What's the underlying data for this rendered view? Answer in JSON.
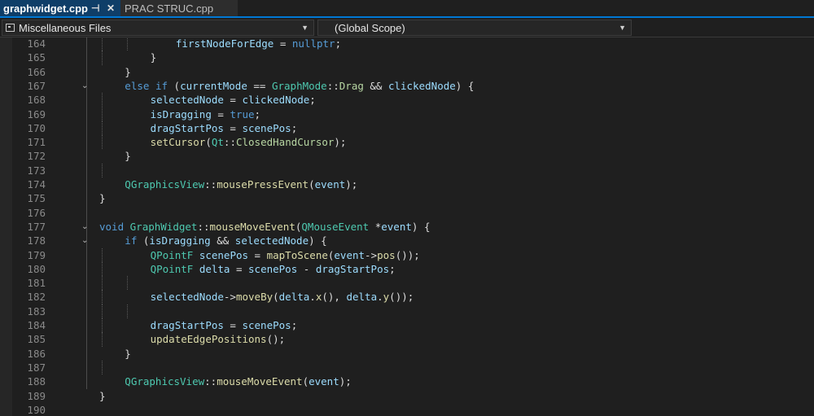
{
  "tabs": [
    {
      "label": "graphwidget.cpp",
      "active": true
    },
    {
      "label": "PRAC STRUC.cpp",
      "active": false
    }
  ],
  "tab_icons": {
    "pin": "pin-icon",
    "close": "close-icon"
  },
  "nav": {
    "project_combo": "Miscellaneous Files",
    "scope_combo": "(Global Scope)"
  },
  "colors": {
    "keyword": "#569cd6",
    "type": "#4ec9b0",
    "function": "#dcdcaa",
    "variable": "#9cdcfe",
    "plain": "#dcdcdc",
    "active_tab": "#0f3e68",
    "accent": "#0078d4"
  },
  "code_lines": [
    {
      "num": "164",
      "indent": 3,
      "fold": false,
      "tokens": [
        [
          "v",
          "firstNodeForEdge"
        ],
        [
          "p",
          " = "
        ],
        [
          "k",
          "nullptr"
        ],
        [
          "p",
          ";"
        ]
      ]
    },
    {
      "num": "165",
      "indent": 2,
      "fold": false,
      "tokens": [
        [
          "p",
          "}"
        ]
      ]
    },
    {
      "num": "166",
      "indent": 1,
      "fold": false,
      "tokens": [
        [
          "p",
          "}"
        ]
      ]
    },
    {
      "num": "167",
      "indent": 1,
      "fold": true,
      "tokens": [
        [
          "k",
          "else"
        ],
        [
          "p",
          " "
        ],
        [
          "k",
          "if"
        ],
        [
          "p",
          " ("
        ],
        [
          "v",
          "currentMode"
        ],
        [
          "p",
          " == "
        ],
        [
          "t",
          "GraphMode"
        ],
        [
          "p",
          "::"
        ],
        [
          "n",
          "Drag"
        ],
        [
          "p",
          " && "
        ],
        [
          "v",
          "clickedNode"
        ],
        [
          "p",
          ") {"
        ]
      ]
    },
    {
      "num": "168",
      "indent": 2,
      "fold": false,
      "tokens": [
        [
          "v",
          "selectedNode"
        ],
        [
          "p",
          " = "
        ],
        [
          "v",
          "clickedNode"
        ],
        [
          "p",
          ";"
        ]
      ]
    },
    {
      "num": "169",
      "indent": 2,
      "fold": false,
      "tokens": [
        [
          "v",
          "isDragging"
        ],
        [
          "p",
          " = "
        ],
        [
          "k",
          "true"
        ],
        [
          "p",
          ";"
        ]
      ]
    },
    {
      "num": "170",
      "indent": 2,
      "fold": false,
      "tokens": [
        [
          "v",
          "dragStartPos"
        ],
        [
          "p",
          " = "
        ],
        [
          "v",
          "scenePos"
        ],
        [
          "p",
          ";"
        ]
      ]
    },
    {
      "num": "171",
      "indent": 2,
      "fold": false,
      "tokens": [
        [
          "m",
          "setCursor"
        ],
        [
          "p",
          "("
        ],
        [
          "t",
          "Qt"
        ],
        [
          "p",
          "::"
        ],
        [
          "n",
          "ClosedHandCursor"
        ],
        [
          "p",
          ");"
        ]
      ]
    },
    {
      "num": "172",
      "indent": 1,
      "fold": false,
      "tokens": [
        [
          "p",
          "}"
        ]
      ]
    },
    {
      "num": "173",
      "indent": 1,
      "fold": false,
      "tokens": []
    },
    {
      "num": "174",
      "indent": 1,
      "fold": false,
      "tokens": [
        [
          "t",
          "QGraphicsView"
        ],
        [
          "p",
          "::"
        ],
        [
          "m",
          "mousePressEvent"
        ],
        [
          "p",
          "("
        ],
        [
          "v",
          "event"
        ],
        [
          "p",
          ");"
        ]
      ]
    },
    {
      "num": "175",
      "indent": 0,
      "fold": false,
      "tokens": [
        [
          "p",
          "}"
        ]
      ]
    },
    {
      "num": "176",
      "indent": 0,
      "fold": false,
      "tokens": []
    },
    {
      "num": "177",
      "indent": 0,
      "fold": true,
      "tokens": [
        [
          "k",
          "void"
        ],
        [
          "p",
          " "
        ],
        [
          "t",
          "GraphWidget"
        ],
        [
          "p",
          "::"
        ],
        [
          "m",
          "mouseMoveEvent"
        ],
        [
          "p",
          "("
        ],
        [
          "t",
          "QMouseEvent"
        ],
        [
          "p",
          " *"
        ],
        [
          "v",
          "event"
        ],
        [
          "p",
          ") {"
        ]
      ]
    },
    {
      "num": "178",
      "indent": 1,
      "fold": true,
      "tokens": [
        [
          "k",
          "if"
        ],
        [
          "p",
          " ("
        ],
        [
          "v",
          "isDragging"
        ],
        [
          "p",
          " && "
        ],
        [
          "v",
          "selectedNode"
        ],
        [
          "p",
          ") {"
        ]
      ]
    },
    {
      "num": "179",
      "indent": 2,
      "fold": false,
      "tokens": [
        [
          "t",
          "QPointF"
        ],
        [
          "p",
          " "
        ],
        [
          "v",
          "scenePos"
        ],
        [
          "p",
          " = "
        ],
        [
          "m",
          "mapToScene"
        ],
        [
          "p",
          "("
        ],
        [
          "v",
          "event"
        ],
        [
          "p",
          "->"
        ],
        [
          "m",
          "pos"
        ],
        [
          "p",
          "());"
        ]
      ]
    },
    {
      "num": "180",
      "indent": 2,
      "fold": false,
      "tokens": [
        [
          "t",
          "QPointF"
        ],
        [
          "p",
          " "
        ],
        [
          "v",
          "delta"
        ],
        [
          "p",
          " = "
        ],
        [
          "v",
          "scenePos"
        ],
        [
          "p",
          " - "
        ],
        [
          "v",
          "dragStartPos"
        ],
        [
          "p",
          ";"
        ]
      ]
    },
    {
      "num": "181",
      "indent": 2,
      "fold": false,
      "tokens": []
    },
    {
      "num": "182",
      "indent": 2,
      "fold": false,
      "tokens": [
        [
          "v",
          "selectedNode"
        ],
        [
          "p",
          "->"
        ],
        [
          "m",
          "moveBy"
        ],
        [
          "p",
          "("
        ],
        [
          "v",
          "delta"
        ],
        [
          "p",
          "."
        ],
        [
          "m",
          "x"
        ],
        [
          "p",
          "(), "
        ],
        [
          "v",
          "delta"
        ],
        [
          "p",
          "."
        ],
        [
          "m",
          "y"
        ],
        [
          "p",
          "());"
        ]
      ]
    },
    {
      "num": "183",
      "indent": 2,
      "fold": false,
      "tokens": []
    },
    {
      "num": "184",
      "indent": 2,
      "fold": false,
      "tokens": [
        [
          "v",
          "dragStartPos"
        ],
        [
          "p",
          " = "
        ],
        [
          "v",
          "scenePos"
        ],
        [
          "p",
          ";"
        ]
      ]
    },
    {
      "num": "185",
      "indent": 2,
      "fold": false,
      "tokens": [
        [
          "m",
          "updateEdgePositions"
        ],
        [
          "p",
          "();"
        ]
      ]
    },
    {
      "num": "186",
      "indent": 1,
      "fold": false,
      "tokens": [
        [
          "p",
          "}"
        ]
      ]
    },
    {
      "num": "187",
      "indent": 1,
      "fold": false,
      "tokens": []
    },
    {
      "num": "188",
      "indent": 1,
      "fold": false,
      "tokens": [
        [
          "t",
          "QGraphicsView"
        ],
        [
          "p",
          "::"
        ],
        [
          "m",
          "mouseMoveEvent"
        ],
        [
          "p",
          "("
        ],
        [
          "v",
          "event"
        ],
        [
          "p",
          ");"
        ]
      ]
    },
    {
      "num": "189",
      "indent": 0,
      "fold": false,
      "tokens": [
        [
          "p",
          "}"
        ]
      ]
    },
    {
      "num": "190",
      "indent": 0,
      "fold": false,
      "tokens": []
    }
  ]
}
